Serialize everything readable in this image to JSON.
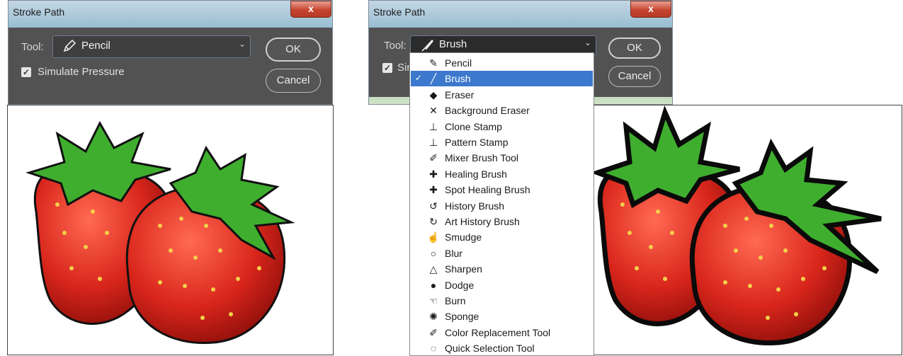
{
  "left_dialog": {
    "title": "Stroke Path",
    "close_glyph": "x",
    "tool_label": "Tool:",
    "tool_value": "Pencil",
    "tool_icon": "pencil-icon",
    "chevron": "⌄",
    "ok_label": "OK",
    "cancel_label": "Cancel",
    "simulate_label": "Simulate Pressure",
    "simulate_checked": true
  },
  "right_dialog": {
    "title": "Stroke Path",
    "close_glyph": "x",
    "tool_label": "Tool:",
    "tool_value": "Brush",
    "tool_icon": "brush-icon",
    "chevron": "⌄",
    "ok_label": "OK",
    "cancel_label": "Cancel",
    "simulate_label_partial": "Sim",
    "simulate_checked": true
  },
  "dropdown": {
    "selected_index": 1,
    "items": [
      {
        "label": "Pencil",
        "icon": "pencil-icon",
        "glyph": "✎"
      },
      {
        "label": "Brush",
        "icon": "brush-icon",
        "glyph": "╱"
      },
      {
        "label": "Eraser",
        "icon": "eraser-icon",
        "glyph": "◆"
      },
      {
        "label": "Background Eraser",
        "icon": "background-eraser-icon",
        "glyph": "✕"
      },
      {
        "label": "Clone Stamp",
        "icon": "clone-stamp-icon",
        "glyph": "⊥"
      },
      {
        "label": "Pattern Stamp",
        "icon": "pattern-stamp-icon",
        "glyph": "⊥"
      },
      {
        "label": "Mixer Brush Tool",
        "icon": "mixer-brush-icon",
        "glyph": "✐"
      },
      {
        "label": "Healing Brush",
        "icon": "healing-brush-icon",
        "glyph": "✚"
      },
      {
        "label": "Spot Healing Brush",
        "icon": "spot-healing-brush-icon",
        "glyph": "✚"
      },
      {
        "label": "History Brush",
        "icon": "history-brush-icon",
        "glyph": "↺"
      },
      {
        "label": "Art History Brush",
        "icon": "art-history-brush-icon",
        "glyph": "↻"
      },
      {
        "label": "Smudge",
        "icon": "smudge-icon",
        "glyph": "☝"
      },
      {
        "label": "Blur",
        "icon": "blur-icon",
        "glyph": "○"
      },
      {
        "label": "Sharpen",
        "icon": "sharpen-icon",
        "glyph": "△"
      },
      {
        "label": "Dodge",
        "icon": "dodge-icon",
        "glyph": "●"
      },
      {
        "label": "Burn",
        "icon": "burn-icon",
        "glyph": "☜"
      },
      {
        "label": "Sponge",
        "icon": "sponge-icon",
        "glyph": "✺"
      },
      {
        "label": "Color Replacement Tool",
        "icon": "color-replacement-icon",
        "glyph": "✐"
      },
      {
        "label": "Quick Selection Tool",
        "icon": "quick-selection-icon",
        "glyph": "◌"
      }
    ]
  },
  "colors": {
    "dialog_body": "#525252",
    "selection_highlight": "#3c78cc",
    "strawberry_red": "#d9261c",
    "leaf_green": "#3fae2f",
    "outline": "#0a0a0a"
  }
}
